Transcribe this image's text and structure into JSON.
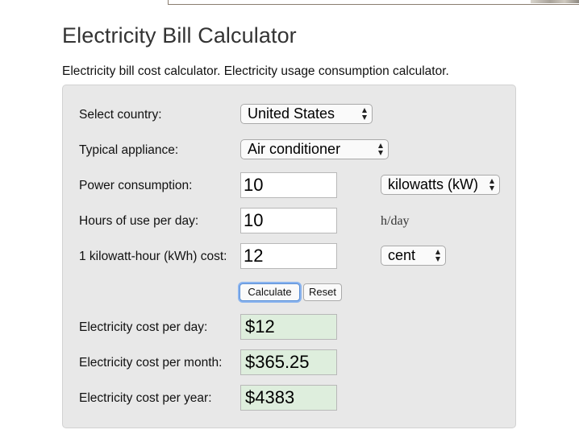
{
  "page": {
    "title": "Electricity Bill Calculator",
    "intro": "Electricity bill cost calculator. Electricity usage consumption calculator."
  },
  "form": {
    "country": {
      "label": "Select country:",
      "value": "United States"
    },
    "appliance": {
      "label": "Typical appliance:",
      "value": "Air conditioner"
    },
    "power": {
      "label": "Power consumption:",
      "value": "10",
      "unit": "kilowatts (kW)"
    },
    "hours": {
      "label": "Hours of use per day:",
      "value": "10",
      "unit": "h/day"
    },
    "cost": {
      "label": "1 kilowatt-hour (kWh) cost:",
      "value": "12",
      "unit": "cent"
    },
    "buttons": {
      "calculate": "Calculate",
      "reset": "Reset"
    }
  },
  "results": {
    "day": {
      "label": "Electricity cost per day:",
      "value": "$12"
    },
    "month": {
      "label": "Electricity cost per month:",
      "value": "$365.25"
    },
    "year": {
      "label": "Electricity cost per year:",
      "value": "$4383"
    }
  },
  "colors": {
    "panel_background": "#e8e8e8",
    "result_background": "#deeedd",
    "focus_ring": "#8ab4ef"
  }
}
